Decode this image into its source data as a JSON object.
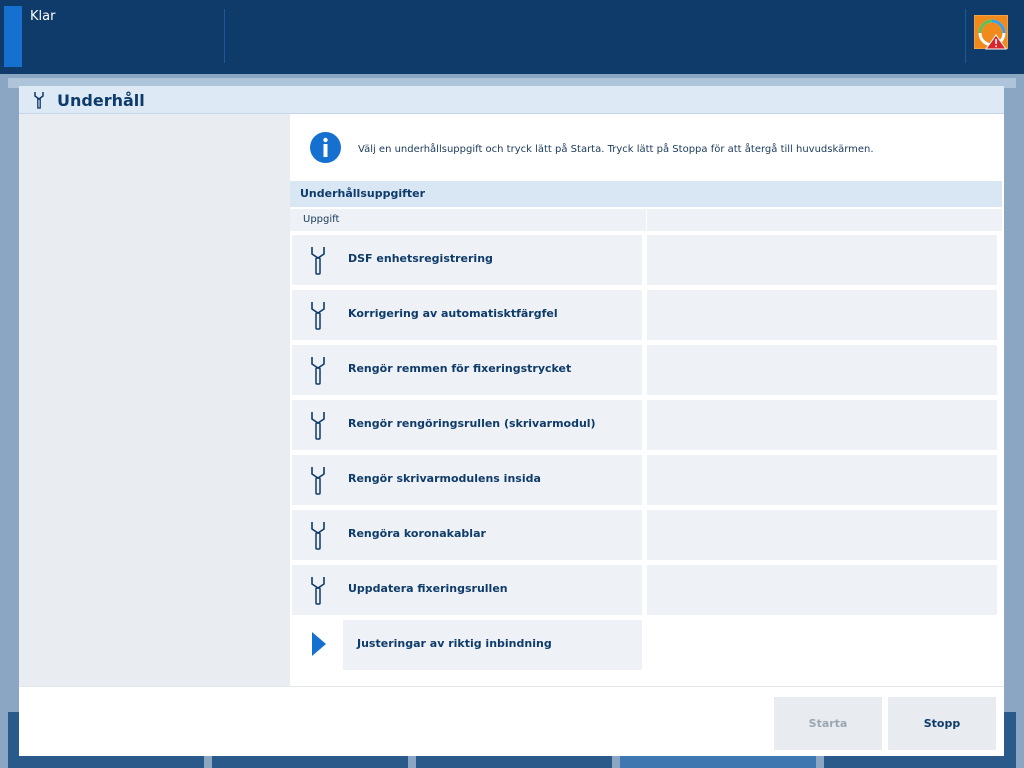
{
  "status": {
    "text": "Klar"
  },
  "dialog": {
    "title": "Underhåll",
    "info": "Välj en underhållsuppgift och tryck lätt på Starta. Tryck lätt på Stoppa för att återgå till huvudskärmen.",
    "section_title": "Underhållsuppgifter",
    "column_task": "Uppgift",
    "tasks": [
      {
        "label": "DSF enhetsregistrering",
        "icon": "wrench-icon"
      },
      {
        "label": "Korrigering av automatisktfärgfel",
        "icon": "wrench-icon"
      },
      {
        "label": "Rengör remmen för fixeringstrycket",
        "icon": "wrench-icon"
      },
      {
        "label": "Rengör rengöringsrullen (skrivarmodul)",
        "icon": "wrench-icon"
      },
      {
        "label": "Rengör skrivarmodulens insida",
        "icon": "wrench-icon"
      },
      {
        "label": "Rengöra koronakablar",
        "icon": "wrench-icon"
      },
      {
        "label": "Uppdatera fixeringsrullen",
        "icon": "wrench-icon"
      }
    ],
    "group_item": {
      "label": "Justeringar av riktig inbindning",
      "icon": "expand-arrow-icon"
    },
    "buttons": {
      "start": "Starta",
      "stop": "Stopp"
    }
  },
  "colors": {
    "navy": "#0e3b6a",
    "accent": "#1570d0",
    "alert": "#f08a1c"
  }
}
